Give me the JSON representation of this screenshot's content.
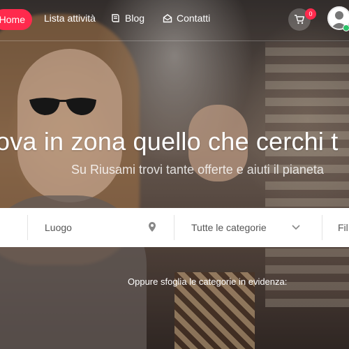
{
  "nav": {
    "home_label": "Home",
    "items": [
      {
        "label": "Lista attività",
        "icon": "none"
      },
      {
        "label": "Blog",
        "icon": "book-icon"
      },
      {
        "label": "Contatti",
        "icon": "envelope-open-icon"
      }
    ],
    "cart_count": "0"
  },
  "hero": {
    "headline": "ova in zona quello che cerchi t",
    "subline": "Su Riusami trovi tante offerte e aiuti il pianeta"
  },
  "search": {
    "location_placeholder": "Luogo",
    "category_selected": "Tutte le categorie",
    "filter_label": "Fil"
  },
  "browse_text": "Oppure sfoglia le categorie in evidenza:",
  "colors": {
    "accent": "#ff2a4d",
    "online": "#2ec26a"
  }
}
